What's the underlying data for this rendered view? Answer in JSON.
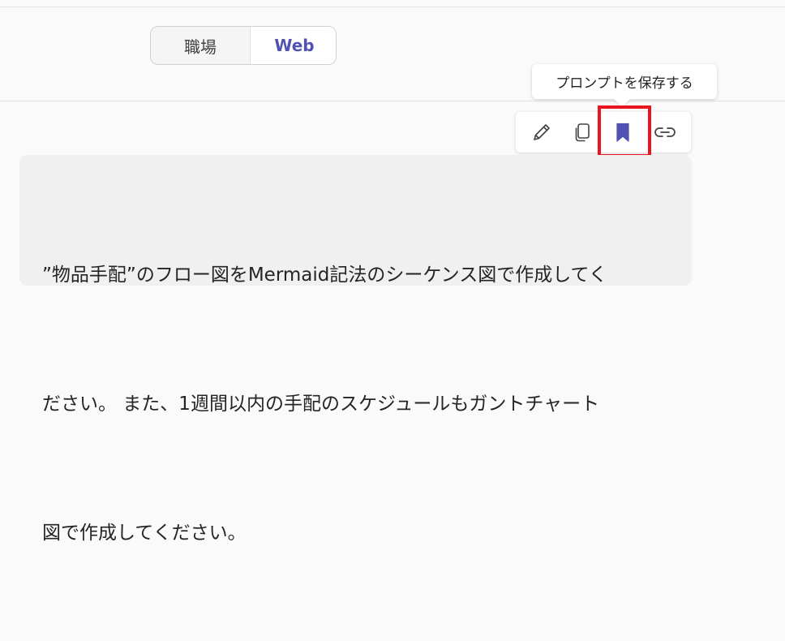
{
  "mode_toggle": {
    "left_label": "職場",
    "right_label": "Web",
    "selected": "Web",
    "accent_color": "#4f52b2"
  },
  "tooltip": {
    "text": "プロンプトを保存する"
  },
  "toolbar": {
    "buttons": [
      {
        "icon": "pencil-icon"
      },
      {
        "icon": "copy-icon"
      },
      {
        "icon": "bookmark-icon",
        "active_color": "#4f52b2"
      },
      {
        "icon": "link-icon"
      }
    ],
    "highlight_color": "#e8141e"
  },
  "message": {
    "lines": [
      "”物品手配”のフロー図をMermaid記法のシーケンス図で作成してく",
      "ださい。 また、1週間以内の手配のスケジュールもガントチャート",
      "図で作成してください。"
    ]
  }
}
